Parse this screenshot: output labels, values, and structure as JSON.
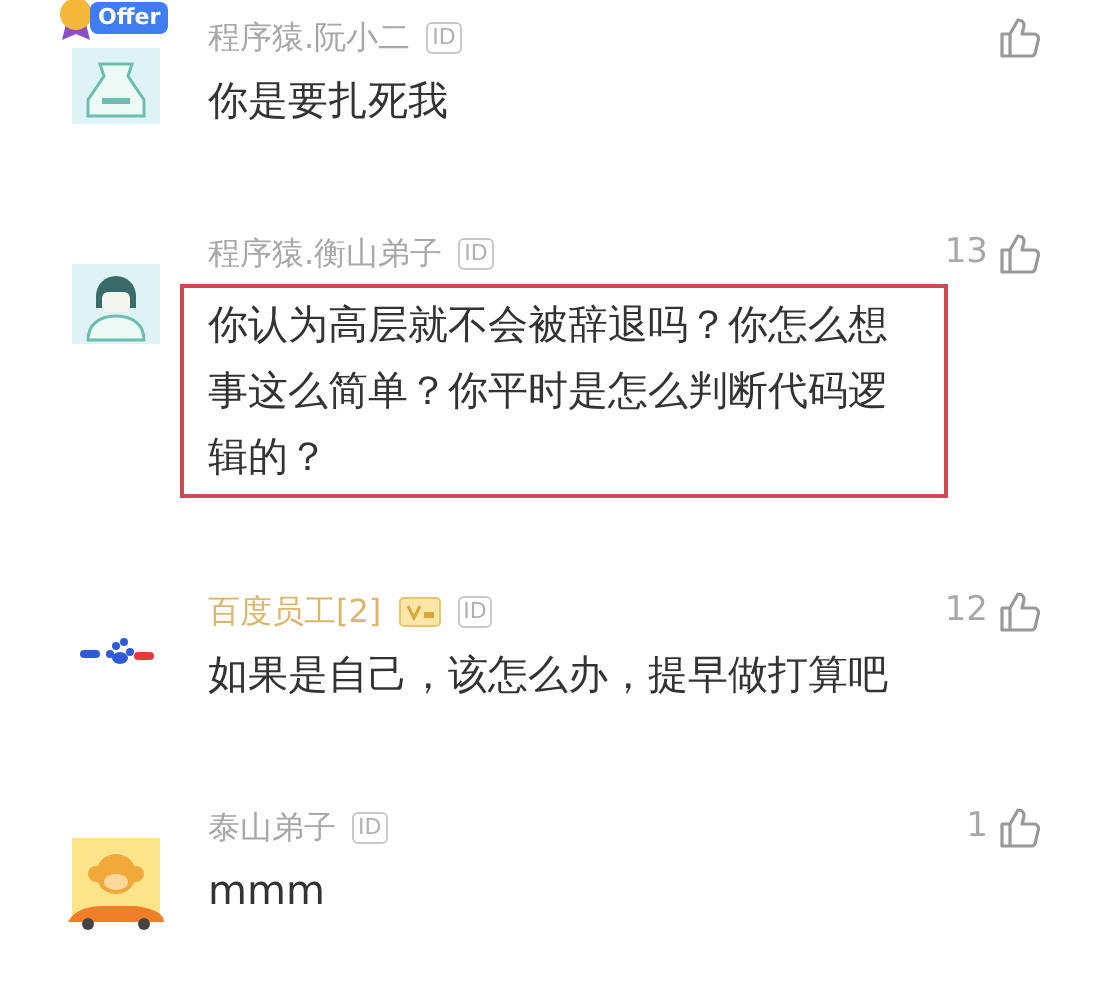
{
  "comments": [
    {
      "kind": "coder-offer",
      "badge": "Offer",
      "name": "程序猿.阮小二",
      "vip": false,
      "level_badge": false,
      "id_tag": "ID",
      "text": "你是要扎死我",
      "highlighted": false
    },
    {
      "kind": "coder-hair",
      "name": "程序猿.衡山弟子",
      "vip": false,
      "level_badge": false,
      "id_tag": "ID",
      "likes": "13",
      "text": "你认为高层就不会被辞退吗？你怎么想事这么简单？你平时是怎么判断代码逻辑的？",
      "highlighted": true
    },
    {
      "kind": "logo",
      "name": "百度员工[2]",
      "vip": true,
      "level_badge": true,
      "id_tag": "ID",
      "likes": "12",
      "text": "如果是自己，该怎么办，提早做打算吧",
      "highlighted": false
    },
    {
      "kind": "monkey-car",
      "name": "泰山弟子",
      "vip": false,
      "level_badge": false,
      "id_tag": "ID",
      "likes": "1",
      "text": "mmm",
      "highlighted": false
    }
  ]
}
